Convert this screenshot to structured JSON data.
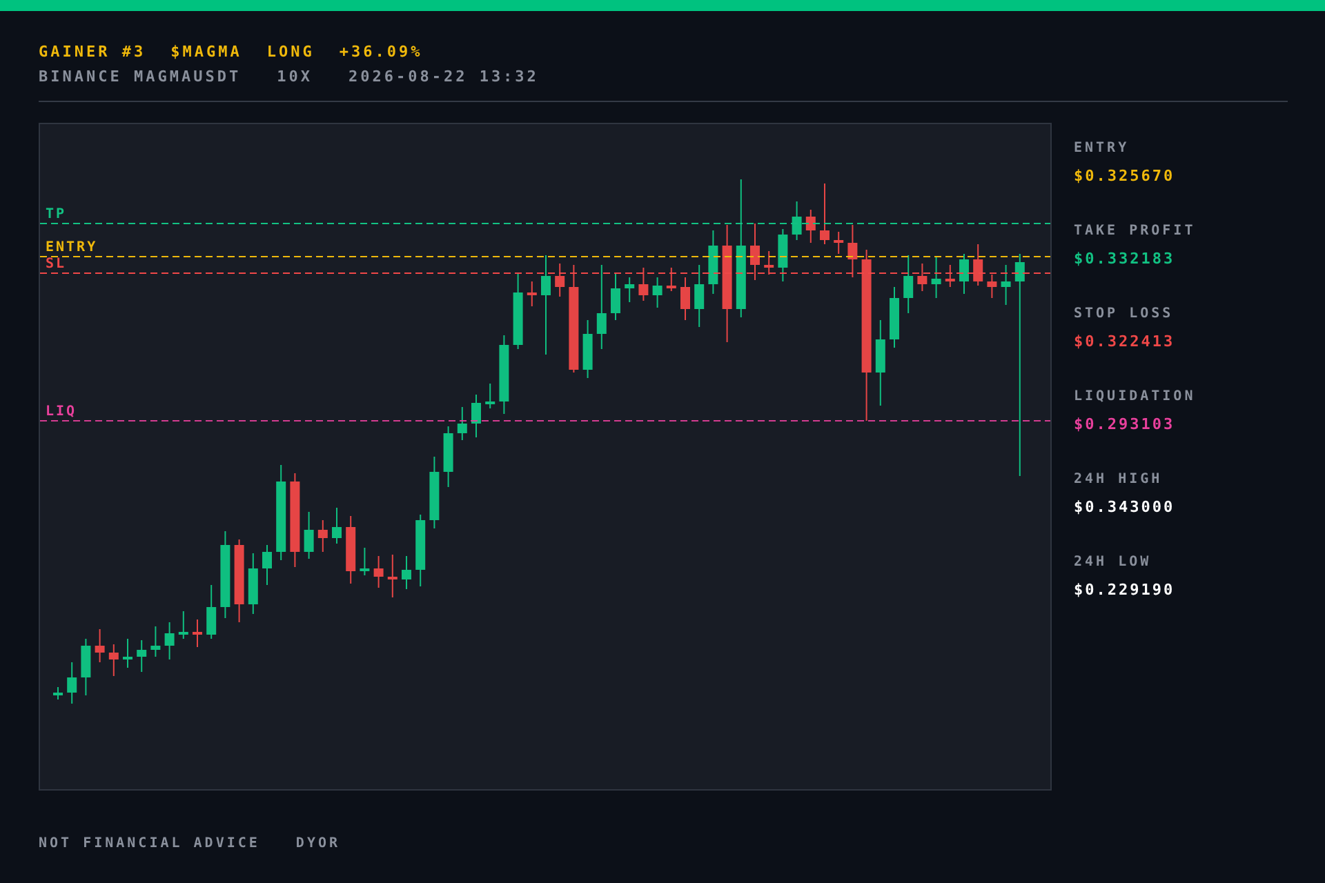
{
  "header": {
    "headline": [
      "GAINER #3",
      "$MAGMA",
      "LONG",
      "+36.09%"
    ],
    "subline": [
      "BINANCE MAGMAUSDT",
      "10X",
      "2026-08-22 13:32"
    ]
  },
  "chart": {
    "lines": [
      {
        "label": "TP",
        "color": "#12c283"
      },
      {
        "label": "ENTRY",
        "color": "#f0b90b"
      },
      {
        "label": "SL",
        "color": "#f04848"
      },
      {
        "label": "LIQ",
        "color": "#e8409c"
      }
    ]
  },
  "stats": [
    {
      "label": "ENTRY",
      "value": "$0.325670",
      "color": "#f0b90b"
    },
    {
      "label": "TAKE PROFIT",
      "value": "$0.332183",
      "color": "#12c283"
    },
    {
      "label": "STOP LOSS",
      "value": "$0.322413",
      "color": "#f04848"
    },
    {
      "label": "LIQUIDATION",
      "value": "$0.293103",
      "color": "#e8409c"
    },
    {
      "label": "24H HIGH",
      "value": "$0.343000",
      "color": "#ffffff"
    },
    {
      "label": "24H LOW",
      "value": "$0.229190",
      "color": "#ffffff"
    }
  ],
  "footer": [
    "NOT FINANCIAL ADVICE",
    "DYOR"
  ]
}
